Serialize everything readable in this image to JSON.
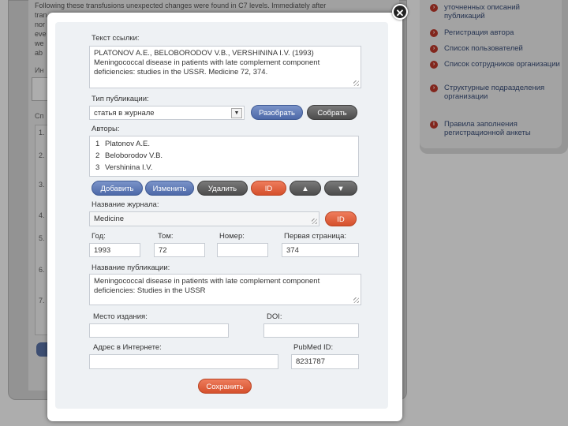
{
  "background": {
    "text_lines": [
      "Following these transfusions unexpected changes were found in C7 levels. Immediately after",
      "tran",
      "nor",
      "eve",
      "we",
      "ab"
    ],
    "label_in": "Ин",
    "label_sp": "Сп",
    "list_numbers": [
      "1.",
      "2.",
      "3.",
      "4.",
      "5.",
      "6.",
      "7."
    ],
    "sidebar": {
      "items": [
        {
          "icon": "arrow-bullet-icon",
          "text": "уточненных описаний публикаций"
        },
        {
          "icon": "arrow-bullet-icon",
          "text": "Регистрация автора"
        },
        {
          "icon": "arrow-bullet-icon",
          "text": "Список пользователей"
        },
        {
          "icon": "arrow-bullet-icon",
          "text": "Список сотрудников организации"
        },
        {
          "icon": "arrow-bullet-icon",
          "text": "Структурные подразделения организации"
        },
        {
          "icon": "info-icon",
          "text": "Правила заполнения регистрационной анкеты"
        }
      ]
    }
  },
  "modal": {
    "close_glyph": "✕",
    "link_text_label": "Текст ссылки:",
    "link_text_value": "PLATONOV A.E., BELOBORODOV V.B., VERSHININA I.V. (1993) Meningococcal disease in patients with late complement component deficiencies: studies in the USSR. Medicine 72, 374.",
    "pub_type_label": "Тип публикации:",
    "pub_type_value": "статья в журнале",
    "parse_button": "Разобрать",
    "assemble_button": "Собрать",
    "authors_label": "Авторы:",
    "authors": [
      {
        "num": "1",
        "name": "Platonov A.E."
      },
      {
        "num": "2",
        "name": "Beloborodov V.B."
      },
      {
        "num": "3",
        "name": "Vershinina I.V."
      }
    ],
    "add_button": "Добавить",
    "edit_button": "Изменить",
    "delete_button": "Удалить",
    "id_button": "ID",
    "up_button": "▲",
    "down_button": "▼",
    "journal_label": "Название журнала:",
    "journal_value": "Medicine",
    "journal_id_button": "ID",
    "year_label": "Год:",
    "year_value": "1993",
    "volume_label": "Том:",
    "volume_value": "72",
    "number_label": "Номер:",
    "number_value": "",
    "first_page_label": "Первая страница:",
    "first_page_value": "374",
    "pub_title_label": "Название публикации:",
    "pub_title_value": "Meningococcal disease in patients with late complement component deficiencies: Studies in the USSR",
    "pub_place_label": "Место издания:",
    "pub_place_value": "",
    "doi_label": "DOI:",
    "doi_value": "",
    "url_label": "Адрес в Интернете:",
    "url_value": "",
    "pubmed_label": "PubMed ID:",
    "pubmed_value": "8231787",
    "save_button": "Сохранить"
  }
}
